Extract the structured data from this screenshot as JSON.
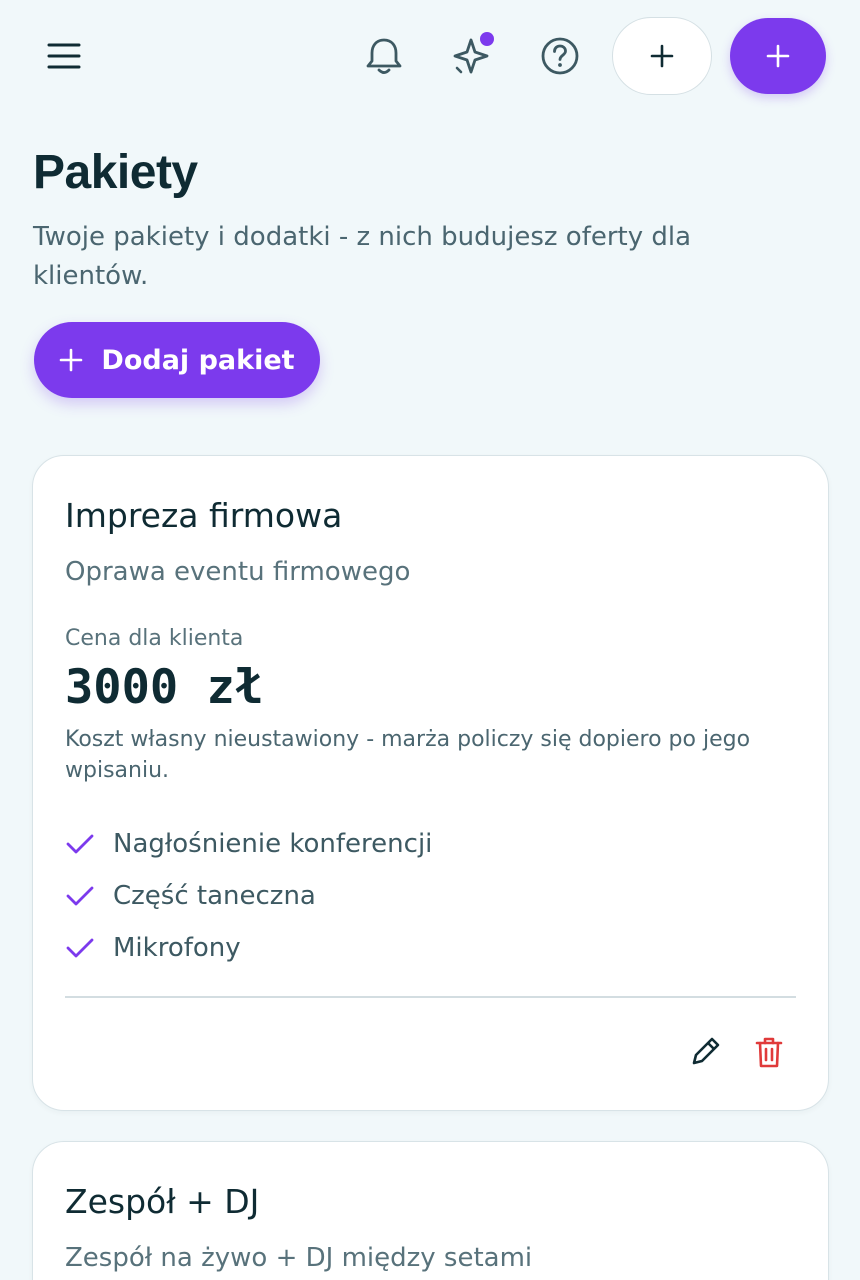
{
  "topbar": {
    "menu_icon": "menu-icon",
    "notifications_icon": "bell-icon",
    "ai_icon": "sparkle-icon",
    "help_icon": "help-circle-icon",
    "quick_add_icon": "plus-icon",
    "primary_add_icon": "plus-icon"
  },
  "header": {
    "title": "Pakiety",
    "subtitle": "Twoje pakiety i dodatki - z nich budujesz oferty dla klientów.",
    "add_button_label": "Dodaj pakiet"
  },
  "colors": {
    "accent": "#7c3aed",
    "background": "#f1f8fa",
    "danger": "#e03a3a"
  },
  "packages": [
    {
      "name": "Impreza firmowa",
      "description": "Oprawa eventu firmowego",
      "price_label": "Cena dla klienta",
      "price": "3000 zł",
      "cost_note": "Koszt własny nieustawiony - marża policzy się dopiero po jego wpisaniu.",
      "features": [
        "Nagłośnienie konferencji",
        "Część taneczna",
        "Mikrofony"
      ]
    },
    {
      "name": "Zespół + DJ",
      "description": "Zespół na żywo + DJ między setami"
    }
  ]
}
